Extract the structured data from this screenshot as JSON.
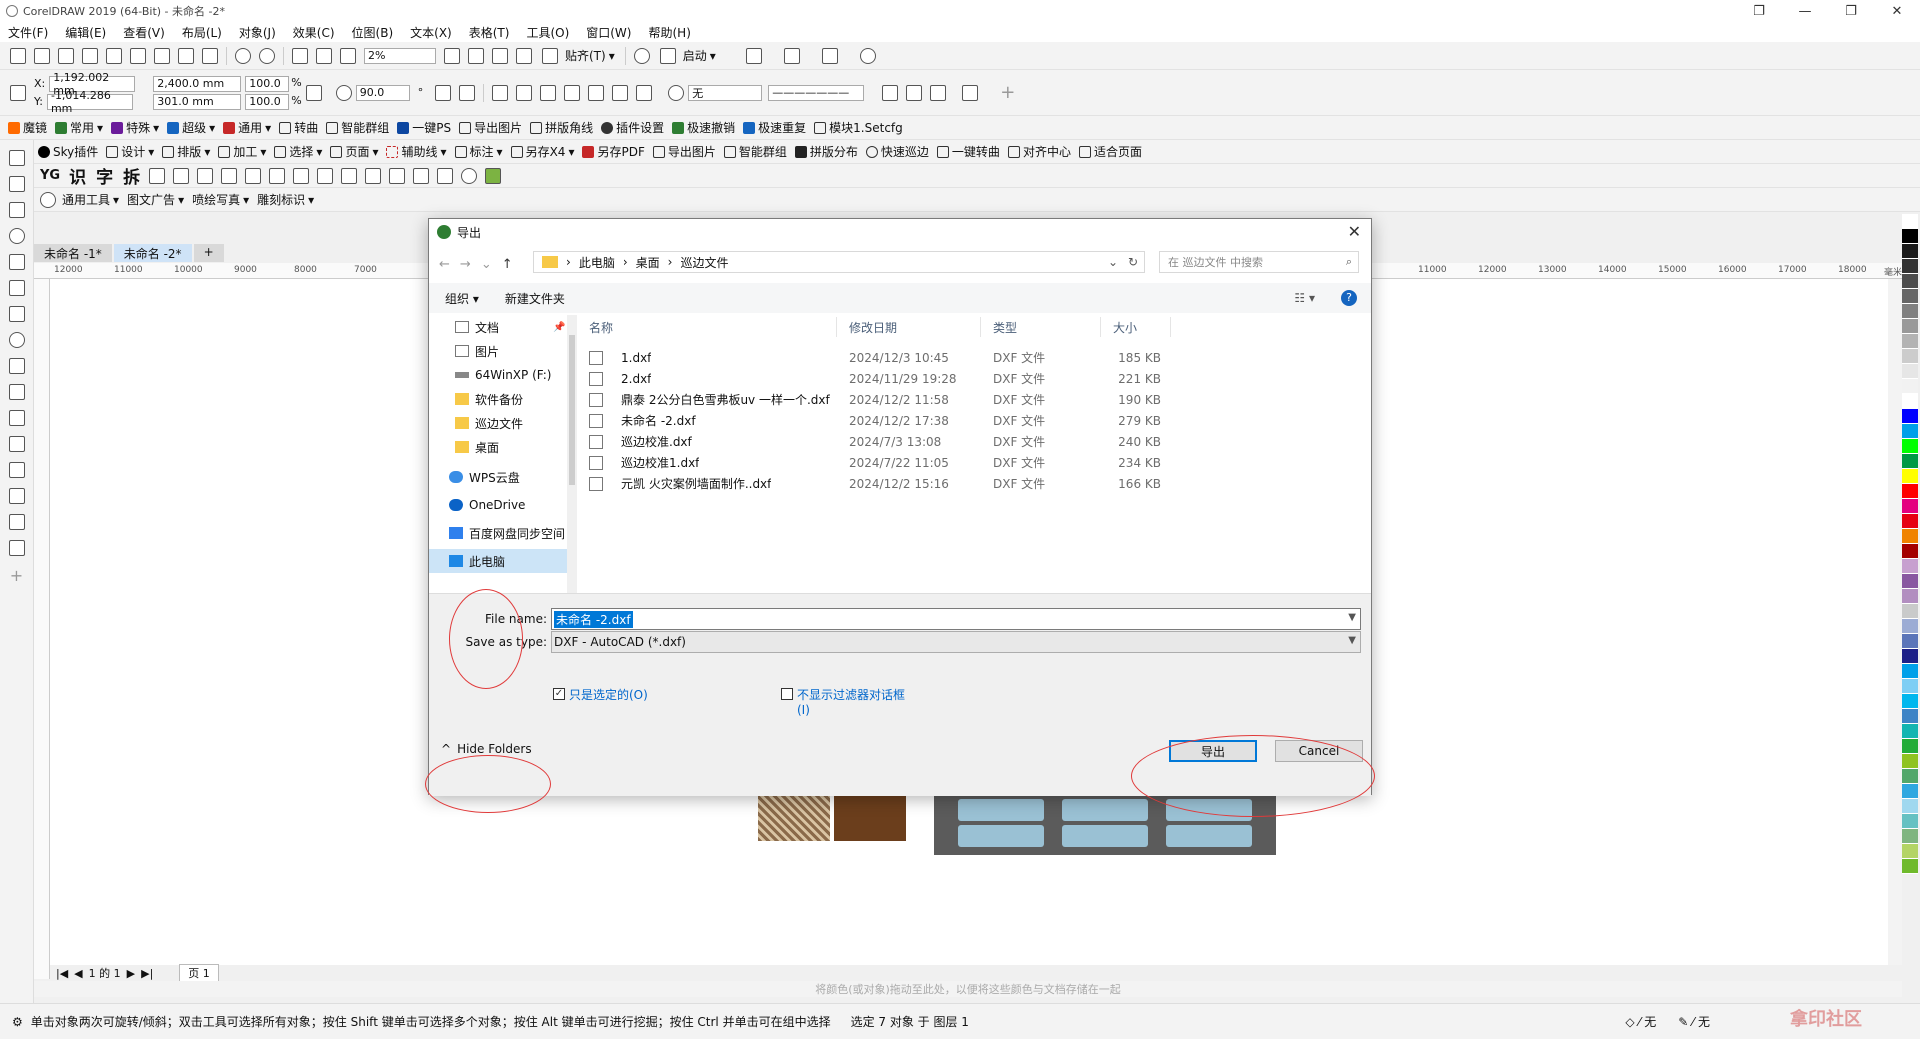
{
  "window": {
    "title": "CorelDRAW 2019 (64-Bit) - 未命名 -2*"
  },
  "menu": [
    "文件(F)",
    "编辑(E)",
    "查看(V)",
    "布局(L)",
    "对象(J)",
    "效果(C)",
    "位图(B)",
    "文本(X)",
    "表格(T)",
    "工具(O)",
    "窗口(W)",
    "帮助(H)"
  ],
  "toolbar1": {
    "zoom": "2%",
    "snap": "贴齐(T)",
    "launch": "启动"
  },
  "propbar": {
    "x": "1,192.002 mm",
    "y": "-1,014.286 mm",
    "w": "2,400.0 mm",
    "h": "301.0 mm",
    "sx": "100.0",
    "sy": "100.0",
    "pct1": "%",
    "pct2": "%",
    "angle": "90.0",
    "deg": "°",
    "fill": "无"
  },
  "plugins1": [
    "魔镜",
    "常用",
    "特殊",
    "超级",
    "通用",
    "转曲",
    "智能群组",
    "一键PS",
    "导出图片",
    "拼版角线",
    "插件设置",
    "极速撤销",
    "极速重复",
    "模块1.Setcfg"
  ],
  "plugins2": [
    "Sky插件",
    "设计",
    "排版",
    "加工",
    "选择",
    "页面",
    "辅助线",
    "标注",
    "另存X4",
    "另存PDF",
    "导出图片",
    "智能群组",
    "拼版分布",
    "快速巡边",
    "一键转曲",
    "对齐中心",
    "适合页面"
  ],
  "plugins3": [
    "识",
    "字",
    "拆"
  ],
  "plugins4": [
    "通用工具",
    "图文广告",
    "喷绘写真",
    "雕刻标识"
  ],
  "doctabs": [
    "未命名 -1*",
    "未命名 -2*"
  ],
  "ruler_ticks": [
    "12000",
    "11000",
    "10000",
    "9000",
    "8000",
    "7000",
    "11000",
    "12000",
    "13000",
    "14000",
    "15000",
    "16000",
    "17000",
    "18000",
    "毫米"
  ],
  "pagebar": {
    "page_count": "1 的 1",
    "page_tab": "页 1"
  },
  "colorbar_hint": "将颜色(或对象)拖动至此处，以便将这些颜色与文档存储在一起",
  "status": {
    "hint": "单击对象两次可旋转/倾斜；双击工具可选择所有对象；按住 Shift 键单击可选择多个对象；按住 Alt 键单击可进行挖掘；按住 Ctrl 并单击可在组中选择",
    "selection": "选定 7 对象 于 图层 1",
    "fill": "无",
    "outline": "无"
  },
  "watermark": "拿印社区",
  "dialog": {
    "title": "导出",
    "breadcrumb": [
      "此电脑",
      "桌面",
      "巡边文件"
    ],
    "search_placeholder": "在 巡边文件 中搜索",
    "organize": "组织 ▾",
    "new_folder": "新建文件夹",
    "nav": [
      {
        "label": "文档",
        "icon": "document-icon"
      },
      {
        "label": "图片",
        "icon": "picture-icon"
      },
      {
        "label": "64WinXP  (F:)",
        "icon": "drive-icon"
      },
      {
        "label": "软件备份",
        "icon": "folder-icon"
      },
      {
        "label": "巡边文件",
        "icon": "folder-icon"
      },
      {
        "label": "桌面",
        "icon": "folder-icon"
      },
      {
        "label": "WPS云盘",
        "icon": "cloud-icon"
      },
      {
        "label": "OneDrive",
        "icon": "cloud-icon"
      },
      {
        "label": "百度网盘同步空间",
        "icon": "sync-folder-icon"
      },
      {
        "label": "此电脑",
        "icon": "pc-icon"
      }
    ],
    "columns": [
      "名称",
      "修改日期",
      "类型",
      "大小"
    ],
    "files": [
      {
        "name": "1.dxf",
        "date": "2024/12/3 10:45",
        "type": "DXF 文件",
        "size": "185 KB"
      },
      {
        "name": "2.dxf",
        "date": "2024/11/29 19:28",
        "type": "DXF 文件",
        "size": "221 KB"
      },
      {
        "name": "鼎泰 2公分白色雪弗板uv  一样一个.dxf",
        "date": "2024/12/2 11:58",
        "type": "DXF 文件",
        "size": "190 KB"
      },
      {
        "name": "未命名 -2.dxf",
        "date": "2024/12/2 17:38",
        "type": "DXF 文件",
        "size": "279 KB"
      },
      {
        "name": "巡边校准.dxf",
        "date": "2024/7/3 13:08",
        "type": "DXF 文件",
        "size": "240 KB"
      },
      {
        "name": "巡边校准1.dxf",
        "date": "2024/7/22 11:05",
        "type": "DXF 文件",
        "size": "234 KB"
      },
      {
        "name": "元凯 火灾案例墙面制作..dxf",
        "date": "2024/12/2 15:16",
        "type": "DXF 文件",
        "size": "166 KB"
      }
    ],
    "file_name_label": "File name:",
    "file_name_value": "未命名 -2.dxf",
    "save_type_label": "Save as type:",
    "save_type_value": "DXF - AutoCAD (*.dxf)",
    "check_selected_only": "只是选定的(O)",
    "check_no_filter_line1": "不显示过滤器对话框",
    "check_no_filter_line2": "(I)",
    "hide_folders": "Hide Folders",
    "export_button": "导出",
    "cancel_button": "Cancel"
  },
  "palette_colors": [
    "#ffffff",
    "#000000",
    "#1a1a1a",
    "#333333",
    "#4d4d4d",
    "#666666",
    "#808080",
    "#999999",
    "#b3b3b3",
    "#cccccc",
    "#e6e6e6",
    "#f2f2f2",
    "#ffffff",
    "#0000ff",
    "#00a0e9",
    "#00ff00",
    "#009944",
    "#ffff00",
    "#ff0000",
    "#e4007f",
    "#e60012",
    "#f08300",
    "#a40000",
    "#c7a0cf",
    "#8957a1",
    "#b28ec0",
    "#c9caca",
    "#9cacd4",
    "#5b75b9",
    "#1d2088",
    "#00a0e9",
    "#7ecef4",
    "#00b7ee",
    "#3e84c6",
    "#13b5b1",
    "#22ac38",
    "#8fc31f",
    "#52a76a",
    "#2ea7e0",
    "#a0d8ef",
    "#66c1c2",
    "#7fb580",
    "#b3d465",
    "#6fba2c"
  ]
}
